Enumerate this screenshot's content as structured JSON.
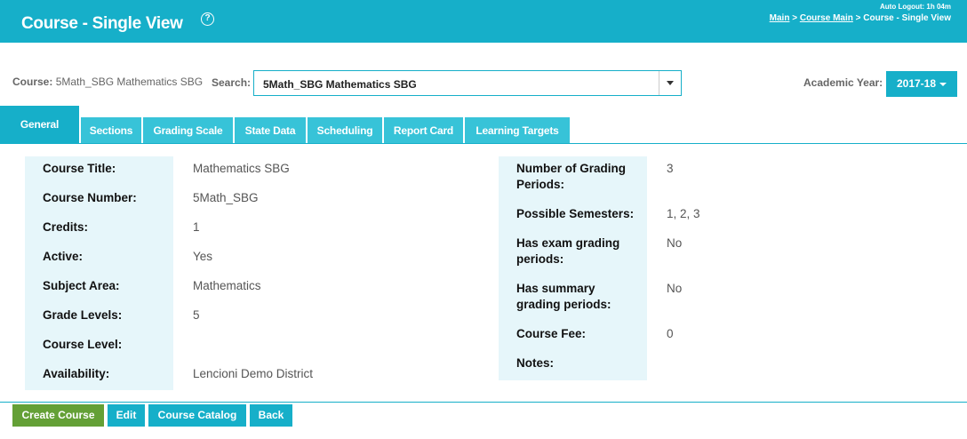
{
  "header": {
    "title": "Course - Single View",
    "help": "?",
    "autologout": "Auto Logout: 1h 04m",
    "crumbs": [
      "Main",
      "Course Main",
      "Course - Single View"
    ],
    "crumb_sep": ">"
  },
  "course": {
    "label": "Course:",
    "value": "5Math_SBG Mathematics SBG"
  },
  "search": {
    "label": "Search:",
    "value": "5Math_SBG Mathematics SBG"
  },
  "academic_year": {
    "label": "Academic Year:",
    "value": "2017-18"
  },
  "tabs": [
    {
      "label": "General",
      "active": true
    },
    {
      "label": "Sections"
    },
    {
      "label": "Grading Scale"
    },
    {
      "label": "State Data"
    },
    {
      "label": "Scheduling"
    },
    {
      "label": "Report Card"
    },
    {
      "label": "Learning Targets"
    }
  ],
  "left_fields": [
    {
      "label": "Course Title:",
      "value": "Mathematics SBG"
    },
    {
      "label": "Course Number:",
      "value": "5Math_SBG"
    },
    {
      "label": "Credits:",
      "value": "1"
    },
    {
      "label": "Active:",
      "value": "Yes"
    },
    {
      "label": "Subject Area:",
      "value": "Mathematics"
    },
    {
      "label": "Grade Levels:",
      "value": "5"
    },
    {
      "label": "Course Level:",
      "value": ""
    },
    {
      "label": "Availability:",
      "value": "Lencioni Demo District"
    }
  ],
  "right_fields": [
    {
      "label_l1": "Number of Grading",
      "label_l2": "Periods:",
      "value": "3"
    },
    {
      "label_l1": "Possible Semesters:",
      "label_l2": "",
      "value": "1, 2, 3"
    },
    {
      "label_l1": "Has exam grading",
      "label_l2": "periods:",
      "value": "No"
    },
    {
      "label_l1": "Has summary",
      "label_l2": "grading periods:",
      "value": "No"
    },
    {
      "label_l1": "Course Fee:",
      "label_l2": "",
      "value": "0"
    },
    {
      "label_l1": "Notes:",
      "label_l2": "",
      "value": ""
    }
  ],
  "buttons": {
    "create": "Create Course",
    "edit": "Edit",
    "catalog": "Course Catalog",
    "back": "Back"
  },
  "colors": {
    "accent": "#16afc9",
    "tab": "#37c3d8",
    "panel": "#e6f6fa",
    "create_button": "#64a036"
  }
}
